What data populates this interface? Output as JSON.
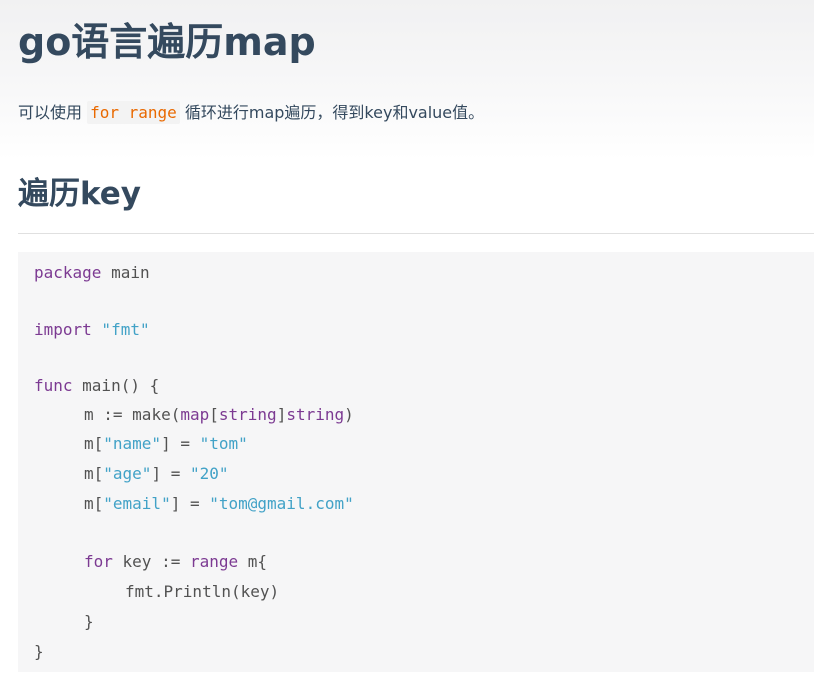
{
  "title": "go语言遍历map",
  "intro": {
    "before": "可以使用 ",
    "code": "for range",
    "after": " 循环进行map遍历，得到key和value值。"
  },
  "section_heading": "遍历key",
  "code": {
    "l1_kw": "package",
    "l1_rest": " main",
    "l2_kw": "import",
    "l2_str": " \"fmt\"",
    "l3_kw": "func",
    "l3_rest": " main() {",
    "l4_a": "m := ",
    "l4_fn": "make",
    "l4_b": "(",
    "l4_kw1": "map",
    "l4_c": "[",
    "l4_kw2": "string",
    "l4_d": "]",
    "l4_kw3": "string",
    "l4_e": ")",
    "l5_a": "m[",
    "l5_s1": "\"name\"",
    "l5_b": "] = ",
    "l5_s2": "\"tom\"",
    "l6_a": "m[",
    "l6_s1": "\"age\"",
    "l6_b": "] = ",
    "l6_s2": "\"20\"",
    "l7_a": "m[",
    "l7_s1": "\"email\"",
    "l7_b": "] = ",
    "l7_s2": "\"tom@gmail.com\"",
    "l8_kw1": "for",
    "l8_a": " key := ",
    "l8_kw2": "range",
    "l8_b": " m{",
    "l9": "fmt.Println(key)",
    "l10": "}",
    "l11": "}"
  }
}
